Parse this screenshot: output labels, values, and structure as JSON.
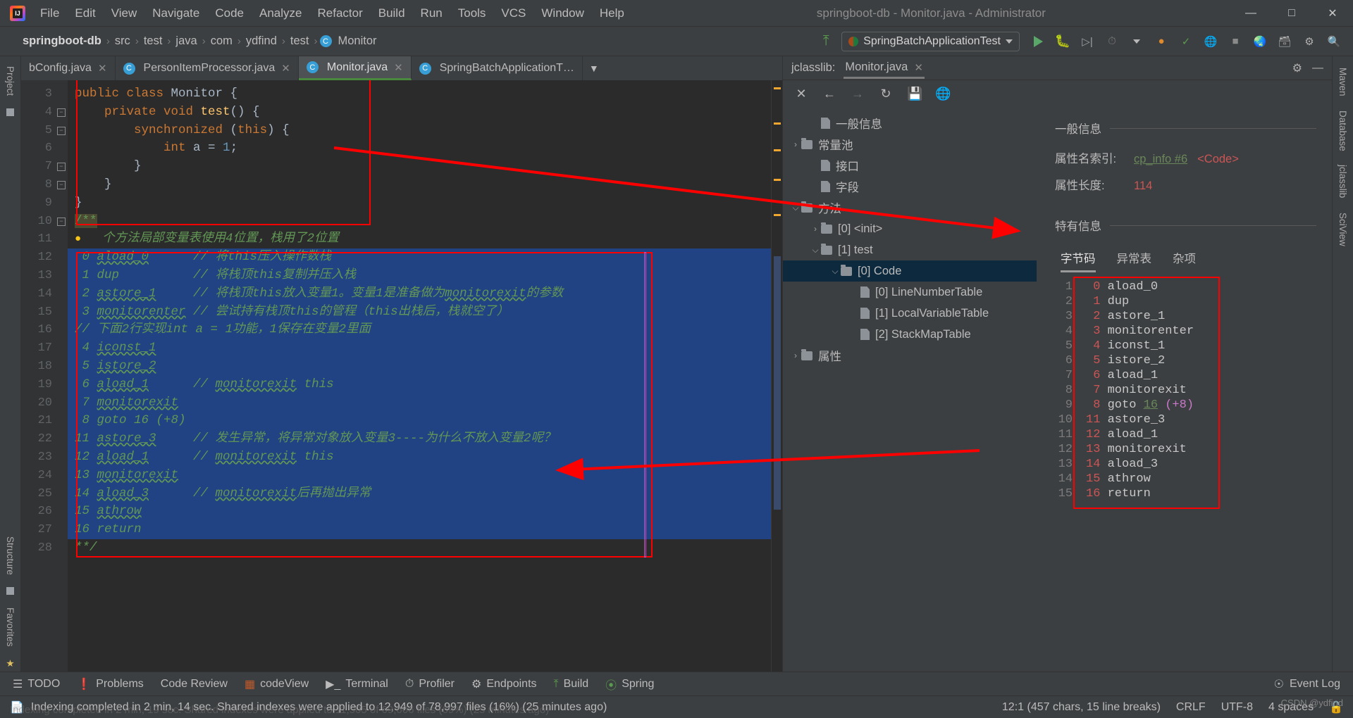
{
  "window": {
    "title": "springboot-db - Monitor.java - Administrator",
    "logo_icon": "intellij-idea-logo",
    "minimize_icon": "minimize-icon",
    "maximize_icon": "maximize-icon",
    "close_icon": "close-icon"
  },
  "menubar": [
    "File",
    "Edit",
    "View",
    "Navigate",
    "Code",
    "Analyze",
    "Refactor",
    "Build",
    "Run",
    "Tools",
    "VCS",
    "Window",
    "Help"
  ],
  "breadcrumb": {
    "items": [
      "springboot-db",
      "src",
      "test",
      "java",
      "com",
      "ydfind",
      "test"
    ],
    "class_badge": "C",
    "class_name": "Monitor",
    "separator": "›"
  },
  "toolbar": {
    "build_icon": "hammer-icon",
    "run_config": "SpringBatchApplicationTest",
    "run_icon": "run-icon",
    "debug_icon": "debug-icon",
    "run_coverage_icon": "run-with-coverage-icon",
    "profile_icon": "profiler-icon",
    "dropdown_icon": "chevron-down-icon",
    "update_icon": "update-project-icon",
    "commit_icon": "commit-icon",
    "search_everywhere_icon": "search-icon",
    "settings_icon": "settings-icon",
    "project_structure_icon": "project-structure-icon"
  },
  "left_rail": [
    "Project",
    "Structure",
    "Favorites"
  ],
  "right_rail": [
    "Maven",
    "Database",
    "jclasslib",
    "SciView"
  ],
  "editor_tabs": [
    {
      "label": "bConfig.java",
      "icon": "java-class-icon",
      "active": false
    },
    {
      "label": "PersonItemProcessor.java",
      "icon": "java-class-icon",
      "active": false
    },
    {
      "label": "Monitor.java",
      "icon": "java-class-icon",
      "active": true
    },
    {
      "label": "SpringBatchApplicationT…",
      "icon": "java-test-class-icon",
      "active": false
    }
  ],
  "editor": {
    "first_line_no": 3,
    "lines": [
      {
        "no": 3,
        "fold": "",
        "segments": [
          {
            "t": "public class ",
            "c": "kw"
          },
          {
            "t": "Monitor {",
            "c": "cls-name"
          }
        ]
      },
      {
        "no": 4,
        "fold": "-",
        "segments": [
          {
            "t": "    private void ",
            "c": "kw"
          },
          {
            "t": "test",
            "c": "meth"
          },
          {
            "t": "() {",
            "c": "cls-name"
          }
        ]
      },
      {
        "no": 5,
        "fold": "-",
        "segments": [
          {
            "t": "        synchronized ",
            "c": "kw"
          },
          {
            "t": "(",
            "c": "cls-name"
          },
          {
            "t": "this",
            "c": "kw"
          },
          {
            "t": ") {",
            "c": "cls-name"
          }
        ]
      },
      {
        "no": 6,
        "fold": "",
        "segments": [
          {
            "t": "            int ",
            "c": "kw"
          },
          {
            "t": "a = ",
            "c": "cls-name"
          },
          {
            "t": "1",
            "c": "num"
          },
          {
            "t": ";",
            "c": "cls-name"
          }
        ]
      },
      {
        "no": 7,
        "fold": "+",
        "segments": [
          {
            "t": "        }",
            "c": "cls-name"
          }
        ]
      },
      {
        "no": 8,
        "fold": "+",
        "segments": [
          {
            "t": "    }",
            "c": "cls-name"
          }
        ]
      },
      {
        "no": 9,
        "fold": "",
        "segments": [
          {
            "t": "}",
            "c": "cls-name"
          }
        ]
      },
      {
        "no": 10,
        "fold": "-",
        "segments": [
          {
            "t": "/**",
            "c": "doc-start"
          }
        ]
      },
      {
        "no": 11,
        "fold": "",
        "segments": [
          {
            "t": "  个方法局部变量表使用4位置，栈用了2位置",
            "c": "cmt"
          }
        ],
        "lamp": true
      },
      {
        "no": 12,
        "fold": "",
        "selected": true,
        "segments": [
          {
            "t": " 0 ",
            "c": "cmt"
          },
          {
            "t": "aload_0",
            "c": "cmt wavy"
          },
          {
            "t": "      // 将this压入操作数栈",
            "c": "cmt"
          }
        ]
      },
      {
        "no": 13,
        "fold": "",
        "selected": true,
        "segments": [
          {
            "t": " 1 dup          // 将栈顶this复制并压入栈",
            "c": "cmt"
          }
        ]
      },
      {
        "no": 14,
        "fold": "",
        "selected": true,
        "segments": [
          {
            "t": " 2 ",
            "c": "cmt"
          },
          {
            "t": "astore_1",
            "c": "cmt wavy"
          },
          {
            "t": "     // 将栈顶this放入变量1。变量1是准备做为",
            "c": "cmt"
          },
          {
            "t": "monitorexit",
            "c": "cmt wavy"
          },
          {
            "t": "的参数",
            "c": "cmt"
          }
        ]
      },
      {
        "no": 15,
        "fold": "",
        "selected": true,
        "segments": [
          {
            "t": " 3 ",
            "c": "cmt"
          },
          {
            "t": "monitorenter",
            "c": "cmt wavy"
          },
          {
            "t": " // 尝试持有栈顶this的管程（this出栈后，栈就空了）",
            "c": "cmt"
          }
        ]
      },
      {
        "no": 16,
        "fold": "",
        "selected": true,
        "segments": [
          {
            "t": "// 下面2行实现int a = 1功能，1保存在变量2里面",
            "c": "cmt"
          }
        ]
      },
      {
        "no": 17,
        "fold": "",
        "selected": true,
        "segments": [
          {
            "t": " 4 ",
            "c": "cmt"
          },
          {
            "t": "iconst_1",
            "c": "cmt wavy"
          }
        ]
      },
      {
        "no": 18,
        "fold": "",
        "selected": true,
        "segments": [
          {
            "t": " 5 ",
            "c": "cmt"
          },
          {
            "t": "istore_2",
            "c": "cmt wavy"
          }
        ]
      },
      {
        "no": 19,
        "fold": "",
        "selected": true,
        "segments": [
          {
            "t": " 6 ",
            "c": "cmt"
          },
          {
            "t": "aload_1",
            "c": "cmt wavy"
          },
          {
            "t": "      // ",
            "c": "cmt"
          },
          {
            "t": "monitorexit",
            "c": "cmt wavy"
          },
          {
            "t": " this",
            "c": "cmt"
          }
        ]
      },
      {
        "no": 20,
        "fold": "",
        "selected": true,
        "segments": [
          {
            "t": " 7 ",
            "c": "cmt"
          },
          {
            "t": "monitorexit",
            "c": "cmt wavy"
          }
        ]
      },
      {
        "no": 21,
        "fold": "",
        "selected": true,
        "segments": [
          {
            "t": " 8 goto 16 (+8)",
            "c": "cmt"
          }
        ]
      },
      {
        "no": 22,
        "fold": "",
        "selected": true,
        "segments": [
          {
            "t": "11 ",
            "c": "cmt"
          },
          {
            "t": "astore_3",
            "c": "cmt wavy"
          },
          {
            "t": "     // 发生异常，将异常对象放入变量3----为什么不放入变量2呢？",
            "c": "cmt"
          }
        ]
      },
      {
        "no": 23,
        "fold": "",
        "selected": true,
        "segments": [
          {
            "t": "12 ",
            "c": "cmt"
          },
          {
            "t": "aload_1",
            "c": "cmt wavy"
          },
          {
            "t": "      // ",
            "c": "cmt"
          },
          {
            "t": "monitorexit",
            "c": "cmt wavy"
          },
          {
            "t": " this",
            "c": "cmt"
          }
        ]
      },
      {
        "no": 24,
        "fold": "",
        "selected": true,
        "segments": [
          {
            "t": "13 ",
            "c": "cmt"
          },
          {
            "t": "monitorexit",
            "c": "cmt wavy"
          }
        ]
      },
      {
        "no": 25,
        "fold": "",
        "selected": true,
        "segments": [
          {
            "t": "14 ",
            "c": "cmt"
          },
          {
            "t": "aload_3",
            "c": "cmt wavy"
          },
          {
            "t": "      // ",
            "c": "cmt"
          },
          {
            "t": "monitorexit",
            "c": "cmt wavy"
          },
          {
            "t": "后再抛出异常",
            "c": "cmt"
          }
        ]
      },
      {
        "no": 26,
        "fold": "",
        "selected": true,
        "segments": [
          {
            "t": "15 ",
            "c": "cmt"
          },
          {
            "t": "athrow",
            "c": "cmt wavy"
          }
        ]
      },
      {
        "no": 27,
        "fold": "",
        "selected": true,
        "segments": [
          {
            "t": "16 return",
            "c": "cmt"
          }
        ]
      },
      {
        "no": 28,
        "fold": "",
        "segments": [
          {
            "t": "**/",
            "c": "cmt"
          }
        ]
      }
    ]
  },
  "jclasslib": {
    "title": "jclasslib:",
    "tab_label": "Monitor.java",
    "tab_close_icon": "close-icon",
    "settings_icon": "gear-icon",
    "minimize_icon": "minimize-icon",
    "toolbar_icons": [
      "close-icon",
      "back-arrow-icon",
      "forward-arrow-icon",
      "refresh-icon",
      "save-icon",
      "globe-icon"
    ],
    "tree": [
      {
        "label": "一般信息",
        "indent": 1,
        "twisty": "",
        "icon": "file-icon",
        "selected": false
      },
      {
        "label": "常量池",
        "indent": 0,
        "twisty": "›",
        "icon": "folder-icon",
        "selected": false
      },
      {
        "label": "接口",
        "indent": 1,
        "twisty": "",
        "icon": "file-icon",
        "selected": false
      },
      {
        "label": "字段",
        "indent": 1,
        "twisty": "",
        "icon": "file-icon",
        "selected": false
      },
      {
        "label": "方法",
        "indent": 0,
        "twisty": "⌄",
        "icon": "folder-icon",
        "selected": false
      },
      {
        "label": "[0] <init>",
        "indent": 1,
        "twisty": "›",
        "icon": "folder-icon",
        "selected": false
      },
      {
        "label": "[1] test",
        "indent": 1,
        "twisty": "⌄",
        "icon": "folder-icon",
        "selected": false
      },
      {
        "label": "[0] Code",
        "indent": 2,
        "twisty": "⌄",
        "icon": "folder-icon",
        "selected": true
      },
      {
        "label": "[0] LineNumberTable",
        "indent": 3,
        "twisty": "",
        "icon": "file-icon",
        "selected": false
      },
      {
        "label": "[1] LocalVariableTable",
        "indent": 3,
        "twisty": "",
        "icon": "file-icon",
        "selected": false
      },
      {
        "label": "[2] StackMapTable",
        "indent": 3,
        "twisty": "",
        "icon": "file-icon",
        "selected": false
      },
      {
        "label": "属性",
        "indent": 0,
        "twisty": "›",
        "icon": "folder-icon",
        "selected": false
      }
    ],
    "detail": {
      "general_title": "一般信息",
      "attr_name_key": "属性名索引:",
      "attr_name_link": "cp_info #6",
      "attr_name_value": "<Code>",
      "attr_len_key": "属性长度:",
      "attr_len_value": "114",
      "specific_title": "特有信息",
      "tabs": [
        "字节码",
        "异常表",
        "杂项"
      ],
      "active_tab": "字节码"
    },
    "bytecode": [
      {
        "n": "1",
        "off": " 0",
        "instr": "aload_0"
      },
      {
        "n": "2",
        "off": " 1",
        "instr": "dup"
      },
      {
        "n": "3",
        "off": " 2",
        "instr": "astore_1"
      },
      {
        "n": "4",
        "off": " 3",
        "instr": "monitorenter"
      },
      {
        "n": "5",
        "off": " 4",
        "instr": "iconst_1"
      },
      {
        "n": "6",
        "off": " 5",
        "instr": "istore_2"
      },
      {
        "n": "7",
        "off": " 6",
        "instr": "aload_1"
      },
      {
        "n": "8",
        "off": " 7",
        "instr": "monitorexit"
      },
      {
        "n": "9",
        "off": " 8",
        "instr": "goto ",
        "link": "16",
        "extra": " (+8)"
      },
      {
        "n": "10",
        "off": "11",
        "instr": "astore_3"
      },
      {
        "n": "11",
        "off": "12",
        "instr": "aload_1"
      },
      {
        "n": "12",
        "off": "13",
        "instr": "monitorexit"
      },
      {
        "n": "13",
        "off": "14",
        "instr": "aload_3"
      },
      {
        "n": "14",
        "off": "15",
        "instr": "athrow"
      },
      {
        "n": "15",
        "off": "16",
        "instr": "return"
      }
    ]
  },
  "bottom_tabs": [
    {
      "label": "TODO",
      "icon": "todo-icon"
    },
    {
      "label": "Problems",
      "icon": "problems-icon"
    },
    {
      "label": "Code Review",
      "icon": "code-review-icon"
    },
    {
      "label": "codeView",
      "icon": "codeview-icon"
    },
    {
      "label": "Terminal",
      "icon": "terminal-icon"
    },
    {
      "label": "Profiler",
      "icon": "profiler-icon"
    },
    {
      "label": "Endpoints",
      "icon": "endpoints-icon"
    },
    {
      "label": "Build",
      "icon": "build-icon"
    },
    {
      "label": "Spring",
      "icon": "spring-icon"
    }
  ],
  "event_log": {
    "label": "Event Log",
    "icon": "event-log-icon"
  },
  "statusbar": {
    "icon": "indexing-icon",
    "message": "Indexing completed in 2 min, 14 sec. Shared indexes were applied to 12,949 of 78,997 files (16%) (25 minutes ago)",
    "ghost_message": "Indexing completed in 2 min, 19 sec. Shared indexes were applied to 11,505 of 69,666 files (69%) (25 minutes ago)",
    "caret": "12:1 (457 chars, 15 line breaks)",
    "line_sep": "CRLF",
    "encoding": "UTF-8",
    "indent": "4 spaces",
    "lock_icon": "unlocked-icon",
    "watermark": "CSDN @ydfind"
  },
  "colors": {
    "accent_red": "#ff0000",
    "selection_blue": "#214283",
    "comment_green": "#629755",
    "keyword_orange": "#cc7832",
    "bg_editor": "#2b2b2b",
    "bg_chrome": "#3c3f41"
  }
}
